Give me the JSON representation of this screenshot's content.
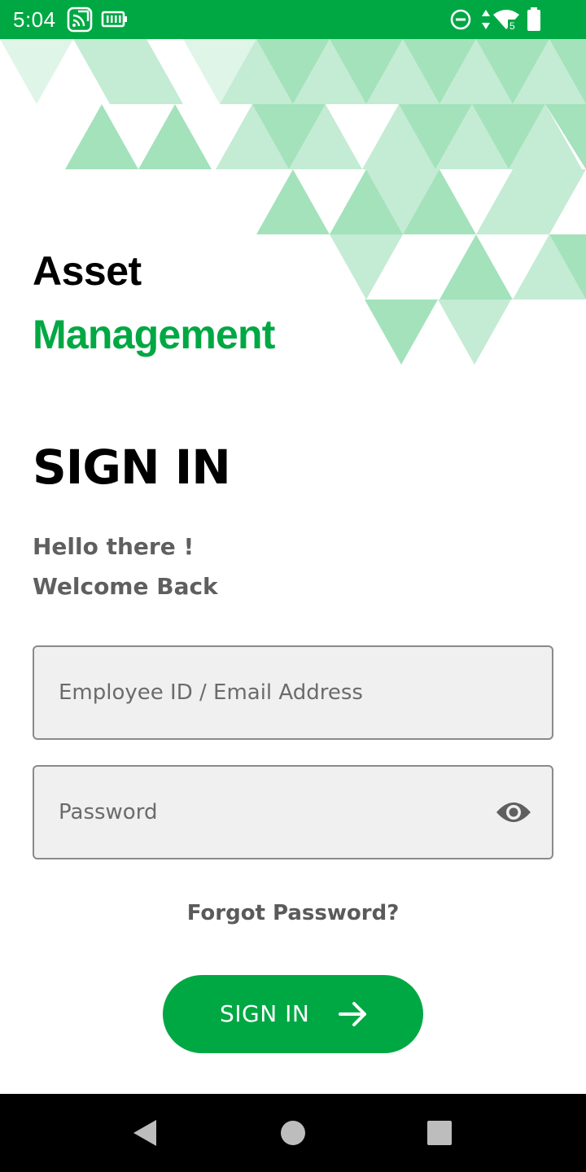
{
  "status_bar": {
    "time": "5:04",
    "icons": [
      "cast-icon",
      "battery-saver-icon",
      "do-not-disturb-icon",
      "data-arrows-icon",
      "wifi-icon",
      "battery-icon"
    ],
    "color": "#00a843"
  },
  "header": {
    "title_line1": "Asset",
    "title_line2": "Management"
  },
  "main": {
    "heading": "SIGN IN",
    "greeting_line1": "Hello there !",
    "greeting_line2": "Welcome Back"
  },
  "form": {
    "email_placeholder": "Employee ID / Email Address",
    "email_value": "",
    "password_placeholder": "Password",
    "password_value": "",
    "password_toggle_icon": "eye-icon",
    "forgot_label": "Forgot Password?",
    "submit_label": "SIGN IN",
    "submit_icon": "arrow-right-icon"
  },
  "nav_bar": {
    "buttons": [
      "back-icon",
      "home-icon",
      "recents-icon"
    ]
  },
  "colors": {
    "brand_green": "#00a843",
    "pattern_light": "#c4ebd4",
    "pattern_mid": "#a3e2bb",
    "text_grey": "#5f5f5f",
    "field_bg": "#f0f0f0"
  }
}
